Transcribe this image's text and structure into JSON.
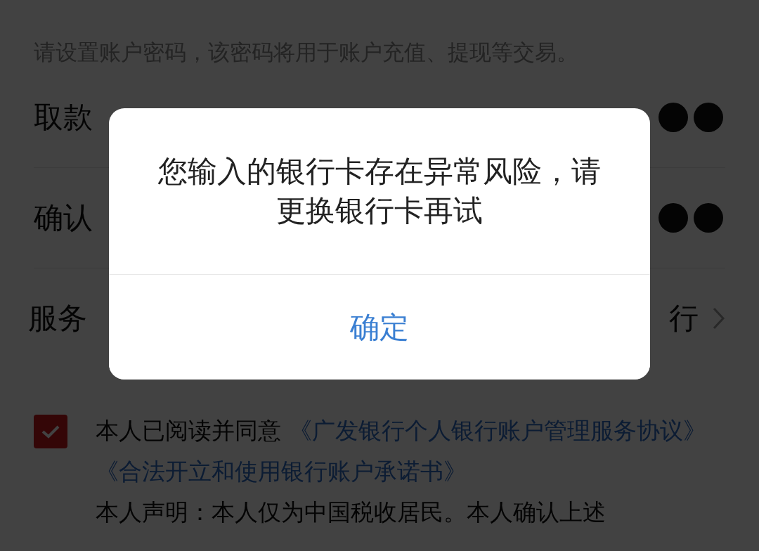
{
  "hint": "请设置账户密码，该密码将用于账户充值、提现等交易。",
  "rows": [
    {
      "kind": "password",
      "label": "取款"
    },
    {
      "kind": "password",
      "label": "确认"
    },
    {
      "kind": "select",
      "label": "服务",
      "value": "行"
    }
  ],
  "agreement": {
    "checked": true,
    "intro": "本人已阅读并同意",
    "links": [
      "《广发银行个人银行账户管理服务协议》",
      "《合法开立和使用银行账户承诺书》"
    ],
    "statement": "本人声明：本人仅为中国税收居民。本人确认上述"
  },
  "dialog": {
    "message": "您输入的银行卡存在异常风险，请更换银行卡再试",
    "button": "确定"
  }
}
